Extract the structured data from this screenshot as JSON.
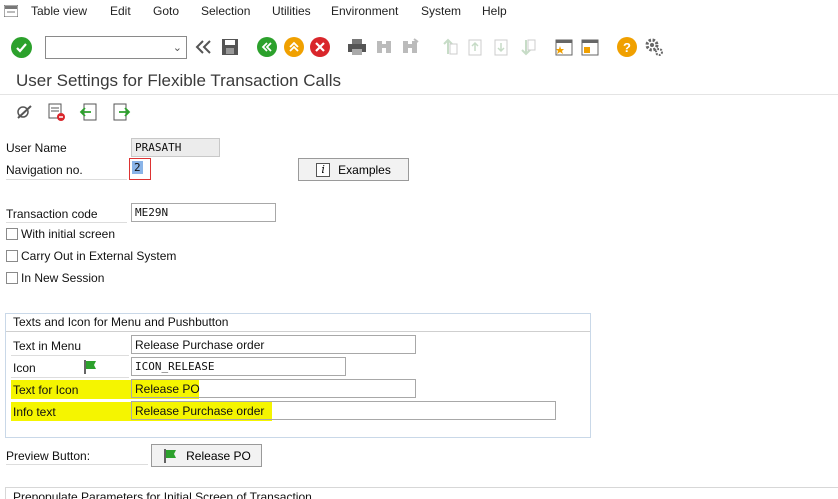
{
  "menubar": {
    "items": [
      {
        "label": "Table view"
      },
      {
        "label": "Edit"
      },
      {
        "label": "Goto"
      },
      {
        "label": "Selection"
      },
      {
        "label": "Utilities"
      },
      {
        "label": "Environment"
      },
      {
        "label": "System"
      },
      {
        "label": "Help"
      }
    ]
  },
  "toolbar": {
    "command_value": "",
    "icons": [
      "enter-icon",
      "back-arrows-icon",
      "save-icon",
      "back-icon",
      "exit-icon",
      "cancel-icon",
      "print-icon",
      "find-icon",
      "find-next-icon",
      "first-page-icon",
      "prev-page-icon",
      "next-page-icon",
      "last-page-icon",
      "new-session-icon",
      "shortcut-icon",
      "help-icon",
      "settings-icon"
    ]
  },
  "page": {
    "title": "User Settings for Flexible Transaction Calls"
  },
  "form": {
    "user_name_label": "User Name",
    "user_name_value": "PRASATH",
    "nav_no_label": "Navigation no.",
    "nav_no_value": "2",
    "examples_button": "Examples",
    "transaction_code_label": "Transaction code",
    "transaction_code_value": "ME29N",
    "with_initial_screen": "With initial screen",
    "carry_out_external": "Carry Out in External System",
    "in_new_session": "In New Session"
  },
  "group": {
    "title": "Texts and Icon for Menu and Pushbutton",
    "text_in_menu_label": "Text in Menu",
    "text_in_menu_value": "Release Purchase order",
    "icon_label": "Icon",
    "icon_value": "ICON_RELEASE",
    "text_for_icon_label": "Text for Icon",
    "text_for_icon_value": "Release PO",
    "info_text_label": "Info text",
    "info_text_value": "Release Purchase order"
  },
  "preview": {
    "label": "Preview Button:",
    "button_label": "Release PO"
  },
  "bottom": {
    "section_title": "Prepopulate Parameters for Initial Screen of Transaction"
  },
  "colors": {
    "enter_green": "#2ca12c",
    "back_green": "#2ca12c",
    "exit_orange": "#f0a000",
    "cancel_red": "#d9262b",
    "help_orange": "#f0a000",
    "highlight_yellow": "#f5f500"
  }
}
